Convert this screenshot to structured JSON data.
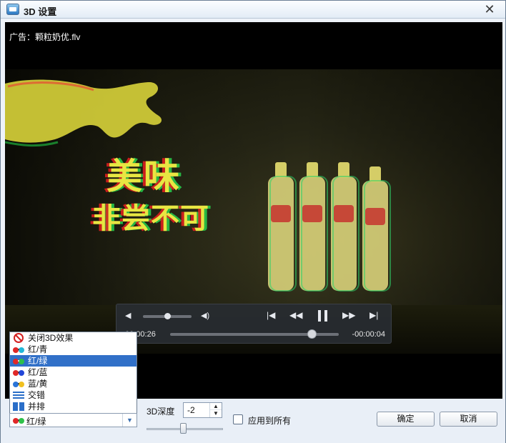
{
  "window": {
    "title": "3D 设置",
    "close_glyph": "✕"
  },
  "video": {
    "ad_label": "广告：颗粒奶优.flv",
    "slogan_line1": "美味",
    "slogan_line2": "非尝不可",
    "player": {
      "time_elapsed": "00:00:26",
      "time_remaining": "-00:00:04",
      "volume_level": 0.5,
      "progress": 0.87
    }
  },
  "mode_list": {
    "items": [
      {
        "label": "关闭3D效果",
        "icon": "no-entry-icon"
      },
      {
        "label": "红/青",
        "icon": "red-cyan-glasses-icon"
      },
      {
        "label": "红/绿",
        "icon": "red-green-glasses-icon"
      },
      {
        "label": "红/蓝",
        "icon": "red-blue-glasses-icon"
      },
      {
        "label": "蓝/黄",
        "icon": "blue-yellow-glasses-icon"
      },
      {
        "label": "交错",
        "icon": "interlaced-icon"
      },
      {
        "label": "并排",
        "icon": "side-by-side-icon"
      }
    ],
    "selected_index": 2
  },
  "mode_combo": {
    "value": "红/绿",
    "icon": "red-green-glasses-icon"
  },
  "depth": {
    "label": "3D深度",
    "value": "-2",
    "slider_level": 0.45
  },
  "apply_all": {
    "label": "应用到所有",
    "checked": false
  },
  "buttons": {
    "ok": "确定",
    "cancel": "取消"
  },
  "colors": {
    "selection": "#3170c8",
    "title_bar": "#e3ecf6",
    "player_bar": "#282c32"
  }
}
